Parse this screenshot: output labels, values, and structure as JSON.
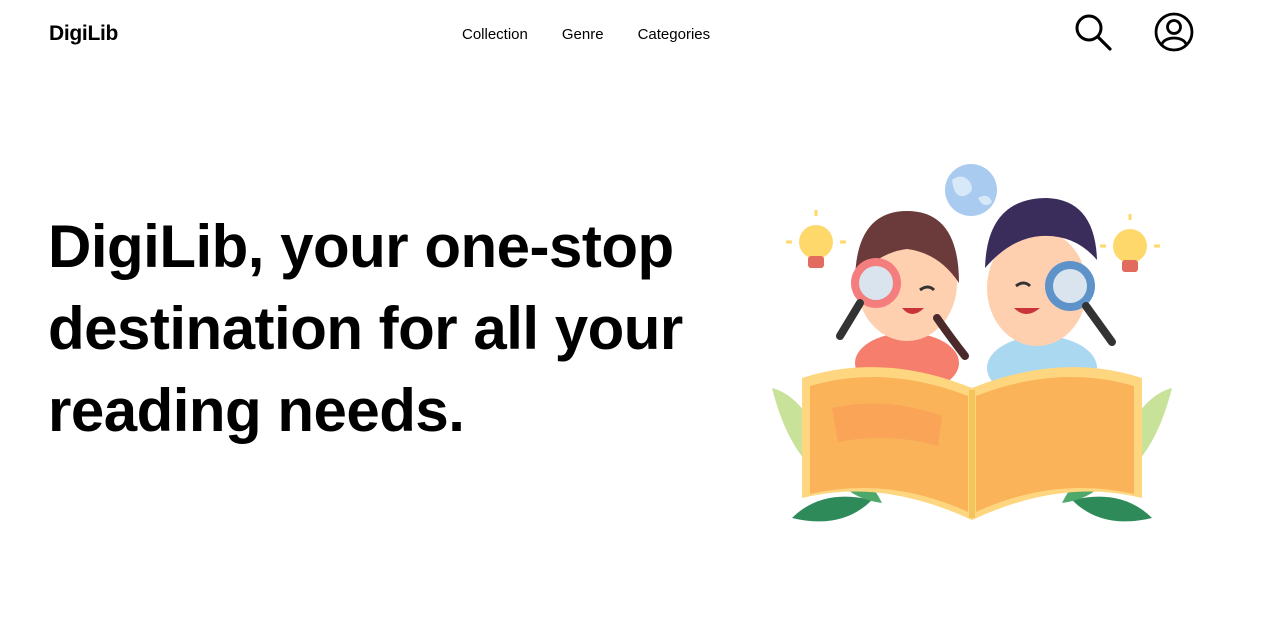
{
  "header": {
    "brand": "DigiLib",
    "nav_items": [
      "Collection",
      "Genre",
      "Categories"
    ],
    "search_icon": "search-icon",
    "account_icon": "user-circle-icon"
  },
  "hero": {
    "title": "DigiLib, your one-stop destination for all your reading needs.",
    "illustration": "kids-reading-book-illustration"
  },
  "colors": {
    "text": "#000000",
    "background": "#ffffff",
    "book": "#fbc15a",
    "leaf_dark": "#2f8a5a",
    "leaf_light": "#c9e29a"
  }
}
